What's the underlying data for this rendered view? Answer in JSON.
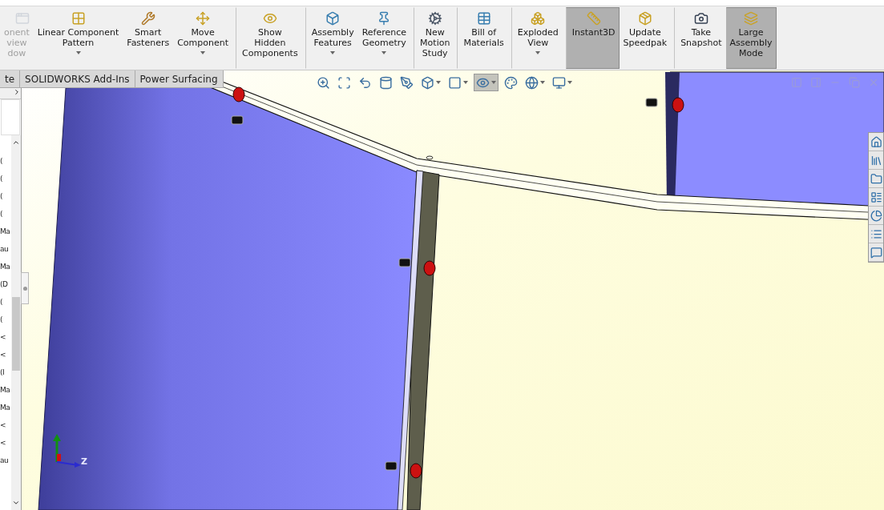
{
  "ribbon": [
    {
      "label": "onent\nview\ndow",
      "disabled": true,
      "menu": false,
      "selected": false,
      "separator_before": false
    },
    {
      "label": "Linear Component\nPattern",
      "disabled": false,
      "menu": true,
      "selected": false,
      "separator_before": false
    },
    {
      "label": "Smart\nFasteners",
      "disabled": false,
      "menu": false,
      "selected": false,
      "separator_before": false
    },
    {
      "label": "Move\nComponent",
      "disabled": false,
      "menu": true,
      "selected": false,
      "separator_before": false
    },
    {
      "label": "Show\nHidden\nComponents",
      "disabled": false,
      "menu": false,
      "selected": false,
      "separator_before": true
    },
    {
      "label": "Assembly\nFeatures",
      "disabled": false,
      "menu": true,
      "selected": false,
      "separator_before": true
    },
    {
      "label": "Reference\nGeometry",
      "disabled": false,
      "menu": true,
      "selected": false,
      "separator_before": false
    },
    {
      "label": "New\nMotion\nStudy",
      "disabled": false,
      "menu": false,
      "selected": false,
      "separator_before": true
    },
    {
      "label": "Bill of\nMaterials",
      "disabled": false,
      "menu": false,
      "selected": false,
      "separator_before": true
    },
    {
      "label": "Exploded\nView",
      "disabled": false,
      "menu": true,
      "selected": false,
      "separator_before": true
    },
    {
      "label": "Instant3D",
      "disabled": false,
      "menu": false,
      "selected": true,
      "separator_before": true
    },
    {
      "label": "Update\nSpeedpak",
      "disabled": false,
      "menu": false,
      "selected": false,
      "separator_before": false
    },
    {
      "label": "Take\nSnapshot",
      "disabled": false,
      "menu": false,
      "selected": false,
      "separator_before": true
    },
    {
      "label": "Large\nAssembly\nMode",
      "disabled": false,
      "menu": false,
      "selected": true,
      "separator_before": false
    }
  ],
  "tabs": [
    {
      "label": "te",
      "selected": false
    },
    {
      "label": "SOLIDWORKS Add-Ins",
      "selected": false
    },
    {
      "label": "Power Surfacing",
      "selected": false
    }
  ],
  "tree_fragments": [
    "(",
    "(",
    "(",
    "(",
    "Ma",
    "au",
    "Ma",
    "(D",
    "(",
    "(",
    "<",
    "<",
    "(I",
    "Ma",
    "Ma",
    "<",
    "<",
    "au"
  ],
  "view_toolbar": [
    {
      "menu": false,
      "selected": false
    },
    {
      "menu": false,
      "selected": false
    },
    {
      "menu": false,
      "selected": false
    },
    {
      "menu": false,
      "selected": false
    },
    {
      "menu": false,
      "selected": false
    },
    {
      "menu": true,
      "selected": false
    },
    {
      "menu": true,
      "selected": false
    },
    {
      "menu": true,
      "selected": true
    },
    {
      "menu": false,
      "selected": false
    },
    {
      "menu": true,
      "selected": false
    },
    {
      "menu": true,
      "selected": false
    }
  ],
  "triad": {
    "x_axis": "Z"
  }
}
